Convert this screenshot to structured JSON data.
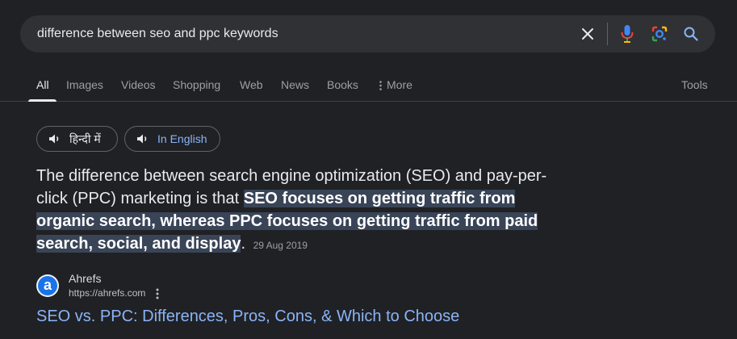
{
  "search": {
    "query": "difference between seo and ppc keywords",
    "icons": [
      "clear-icon",
      "microphone-icon",
      "lens-icon",
      "search-icon"
    ]
  },
  "tabs": [
    {
      "label": "All",
      "active": true
    },
    {
      "label": "Images"
    },
    {
      "label": "Videos"
    },
    {
      "label": "Shopping"
    },
    {
      "label": "Web"
    },
    {
      "label": "News"
    },
    {
      "label": "Books"
    },
    {
      "label": "More"
    }
  ],
  "tools_label": "Tools",
  "language_chips": [
    {
      "label": "हिन्दी में",
      "icon": "speaker-icon"
    },
    {
      "label": "In English",
      "icon": "speaker-icon"
    }
  ],
  "snippet": {
    "prefix": "The difference between search engine optimization (SEO) and pay-per-click (PPC) marketing is that ",
    "highlight": "SEO focuses on getting traffic from organic search, whereas PPC focuses on getting traffic from paid search, social, and display",
    "suffix": ".",
    "date": "29 Aug 2019"
  },
  "source": {
    "favicon_letter": "a",
    "name": "Ahrefs",
    "url": "https://ahrefs.com",
    "title": "SEO vs. PPC: Differences, Pros, Cons, & Which to Choose"
  },
  "colors": {
    "background": "#202124",
    "search_bar": "#303134",
    "link": "#8ab4f8",
    "highlight": "#394457"
  }
}
